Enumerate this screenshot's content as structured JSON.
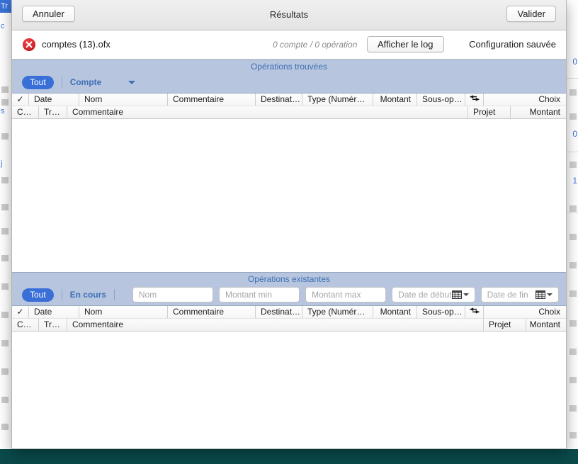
{
  "window": {
    "titlebar": {
      "cancel_label": "Annuler",
      "title": "Résultats",
      "validate_label": "Valider"
    },
    "file_row": {
      "status_icon": "error-circle-icon",
      "filename": "comptes (13).ofx",
      "counts": "0 compte / 0 opération",
      "show_log_label": "Afficher le log",
      "config_status": "Configuration sauvée"
    }
  },
  "sections": [
    {
      "key": "found",
      "band_title": "Opérations trouvées",
      "controls": {
        "all_pill": "Tout",
        "account_label": "Compte",
        "chevron_icon": "chevron-down-icon"
      },
      "columns_row1": [
        {
          "label": "✓",
          "align": "center"
        },
        {
          "label": "Date",
          "align": "left"
        },
        {
          "label": "Nom",
          "align": "left"
        },
        {
          "label": "Commentaire",
          "align": "left"
        },
        {
          "label": "Destinat…",
          "align": "left"
        },
        {
          "label": "Type (Numér…",
          "align": "left"
        },
        {
          "label": "Montant",
          "align": "right"
        },
        {
          "label": "Sous-op…",
          "align": "left"
        },
        {
          "label": "transfer-arrows-icon",
          "align": "center"
        },
        {
          "label": "Choix",
          "align": "right"
        }
      ],
      "columns_row2": [
        {
          "label": "C…",
          "align": "left"
        },
        {
          "label": "Tr…",
          "align": "left"
        },
        {
          "label": "Commentaire",
          "align": "left"
        },
        {
          "label": "",
          "align": "left"
        },
        {
          "label": "Projet",
          "align": "left"
        },
        {
          "label": "Montant",
          "align": "right"
        }
      ],
      "rows": []
    },
    {
      "key": "existing",
      "band_title": "Opérations existantes",
      "controls": {
        "all_pill": "Tout",
        "status_label": "En cours",
        "name_placeholder": "Nom",
        "amount_min_placeholder": "Montant min",
        "amount_max_placeholder": "Montant max",
        "date_start_placeholder": "Date de début",
        "date_end_placeholder": "Date de fin",
        "calendar_icon": "calendar-icon"
      },
      "columns_row1": [
        {
          "label": "✓",
          "align": "center"
        },
        {
          "label": "Date",
          "align": "left"
        },
        {
          "label": "Nom",
          "align": "left"
        },
        {
          "label": "Commentaire",
          "align": "left"
        },
        {
          "label": "Destinat…",
          "align": "left"
        },
        {
          "label": "Type (Numér…",
          "align": "left"
        },
        {
          "label": "Montant",
          "align": "right"
        },
        {
          "label": "Sous-op…",
          "align": "left"
        },
        {
          "label": "transfer-arrows-icon",
          "align": "center"
        },
        {
          "label": "Choix",
          "align": "right"
        }
      ],
      "columns_row2": [
        {
          "label": "C…",
          "align": "left"
        },
        {
          "label": "Tr…",
          "align": "left"
        },
        {
          "label": "Commentaire",
          "align": "left"
        },
        {
          "label": "",
          "align": "left"
        },
        {
          "label": "Projet",
          "align": "left"
        },
        {
          "label": "Montant",
          "align": "right"
        }
      ],
      "rows": []
    }
  ],
  "background_window": {
    "left_strip": {
      "header": "Tr",
      "rows": [
        "c",
        "s",
        "j"
      ]
    },
    "right_strip": {
      "values": [
        "0",
        "0",
        "1"
      ]
    }
  },
  "colors": {
    "accent_blue": "#3a6fd8",
    "band_blue": "#b7c6de",
    "band_text": "#3f6fb5",
    "error_red": "#cf1f24",
    "desktop_teal": "#0d5b5b"
  }
}
